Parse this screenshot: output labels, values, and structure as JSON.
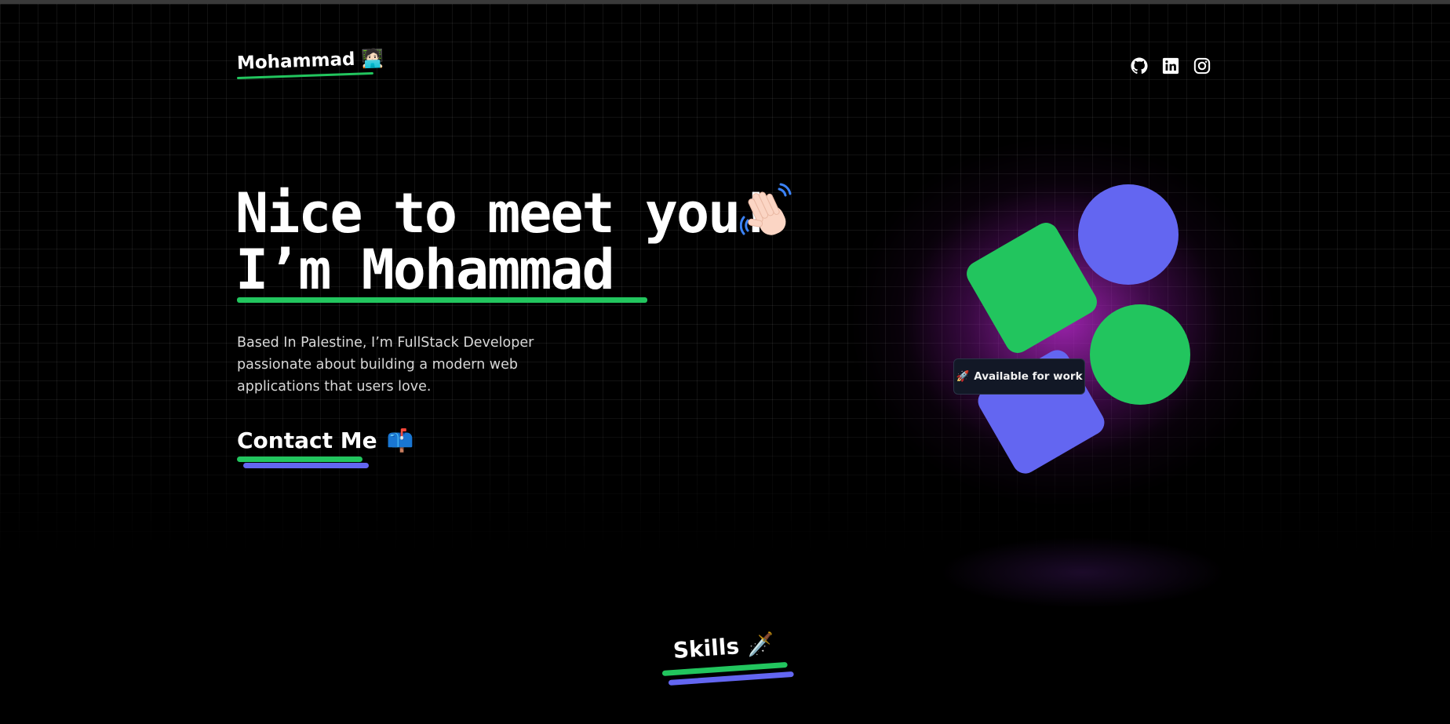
{
  "header": {
    "logo_text": "Mohammad",
    "logo_emoji": "🧑🏻‍💻",
    "social_icons": [
      "github-icon",
      "linkedin-icon",
      "instagram-icon"
    ]
  },
  "hero": {
    "line1": "Nice to meet you!",
    "line2": "I’m Mohammad",
    "wave_icon": "waving-hand-icon",
    "bio": "Based In Palestine, I’m FullStack Developer passionate about building a modern web applications that users love.",
    "contact_label": "Contact Me",
    "contact_emoji": "📫"
  },
  "illustration": {
    "badge_emoji": "🚀",
    "badge_text": "Available for work"
  },
  "skills": {
    "title": "Skills",
    "emoji": "🗡️"
  },
  "colors": {
    "background": "#000000",
    "accent_green": "#22c55e",
    "accent_purple": "#6366f1",
    "glow": "#b428c8",
    "text": "#ffffff"
  }
}
